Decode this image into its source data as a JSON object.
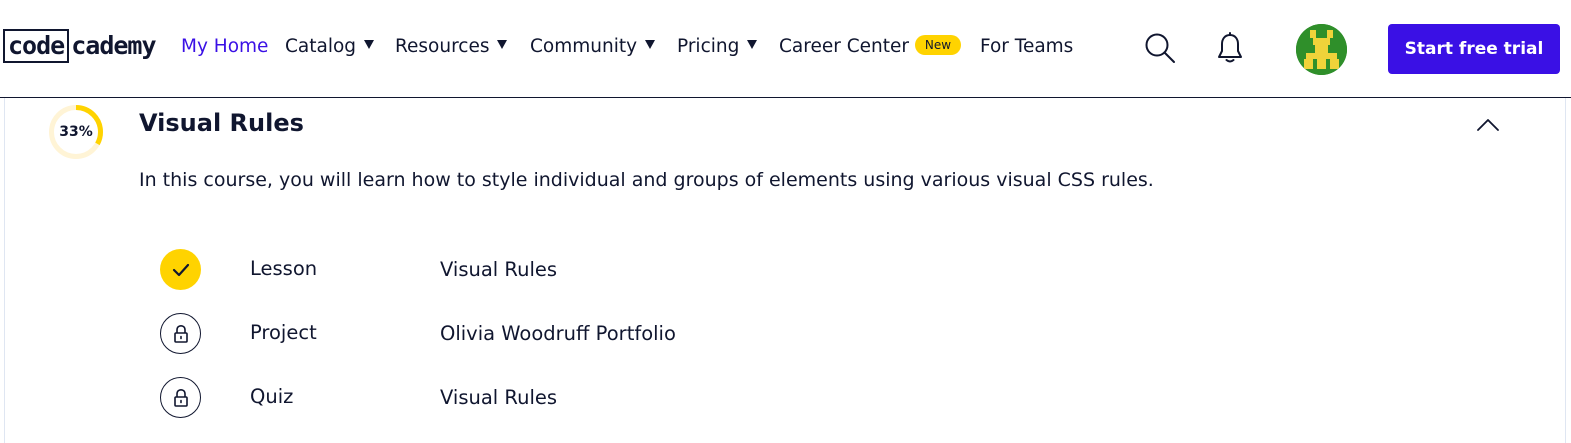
{
  "nav": {
    "logo_boxed": "code",
    "logo_rest": "cademy",
    "items": [
      {
        "label": "My Home"
      },
      {
        "label": "Catalog"
      },
      {
        "label": "Resources"
      },
      {
        "label": "Community"
      },
      {
        "label": "Pricing"
      },
      {
        "label": "Career Center"
      },
      {
        "label": "For Teams"
      }
    ],
    "badge": "New",
    "cta": "Start free trial",
    "colors": {
      "accent": "#3a10e5",
      "badge": "#ffd300",
      "text": "#10162f"
    }
  },
  "course": {
    "progress_label": "33%",
    "progress": 0.33,
    "title": "Visual Rules",
    "description": "In this course, you will learn how to style individual and groups of elements using various visual CSS rules.",
    "items": [
      {
        "type": "Lesson",
        "name": "Visual Rules",
        "status": "completed"
      },
      {
        "type": "Project",
        "name": "Olivia Woodruff Portfolio",
        "status": "locked"
      },
      {
        "type": "Quiz",
        "name": "Visual Rules",
        "status": "locked"
      }
    ]
  }
}
